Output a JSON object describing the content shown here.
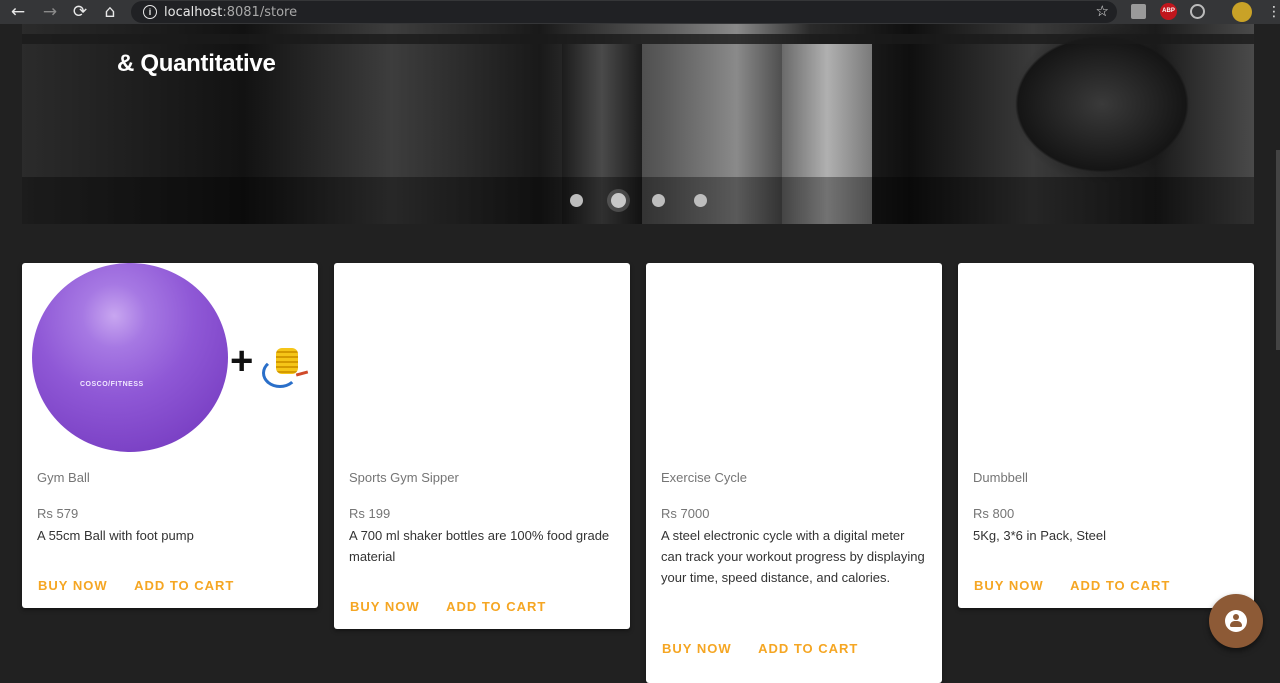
{
  "browser": {
    "url_host": "localhost",
    "url_rest": ":8081/store",
    "nav": {
      "back": "←",
      "forward": "→",
      "reload": "⟳",
      "home": "⌂"
    },
    "star": "☆",
    "abp": "ABP",
    "menu": "⋮",
    "info": "i"
  },
  "hero": {
    "title": "& Quantitative",
    "slides": 4,
    "active_slide": 2
  },
  "products": [
    {
      "name": "Gym Ball",
      "price": "Rs 579",
      "description": "A 55cm Ball with foot pump",
      "image": "ball-with-pump",
      "brand": "COSCO FITNESS"
    },
    {
      "name": "Sports Gym Sipper",
      "price": "Rs 199",
      "description": "A 700 ml shaker bottles are 100% food grade material",
      "image": "none"
    },
    {
      "name": "Exercise Cycle",
      "price": "Rs 7000",
      "description": "A steel electronic cycle with a digital meter can track your workout progress by displaying your time, speed distance, and calories.",
      "image": "none"
    },
    {
      "name": "Dumbbell",
      "price": "Rs 800",
      "description": "5Kg, 3*6 in Pack, Steel",
      "image": "none"
    }
  ],
  "actions": {
    "buy_now": "BUY NOW",
    "add_to_cart": "ADD TO CART"
  },
  "colors": {
    "background": "#212121",
    "accent": "#f5a623",
    "fab": "#8d5a36",
    "card": "#ffffff"
  },
  "fab": {
    "icon": "account-icon"
  }
}
